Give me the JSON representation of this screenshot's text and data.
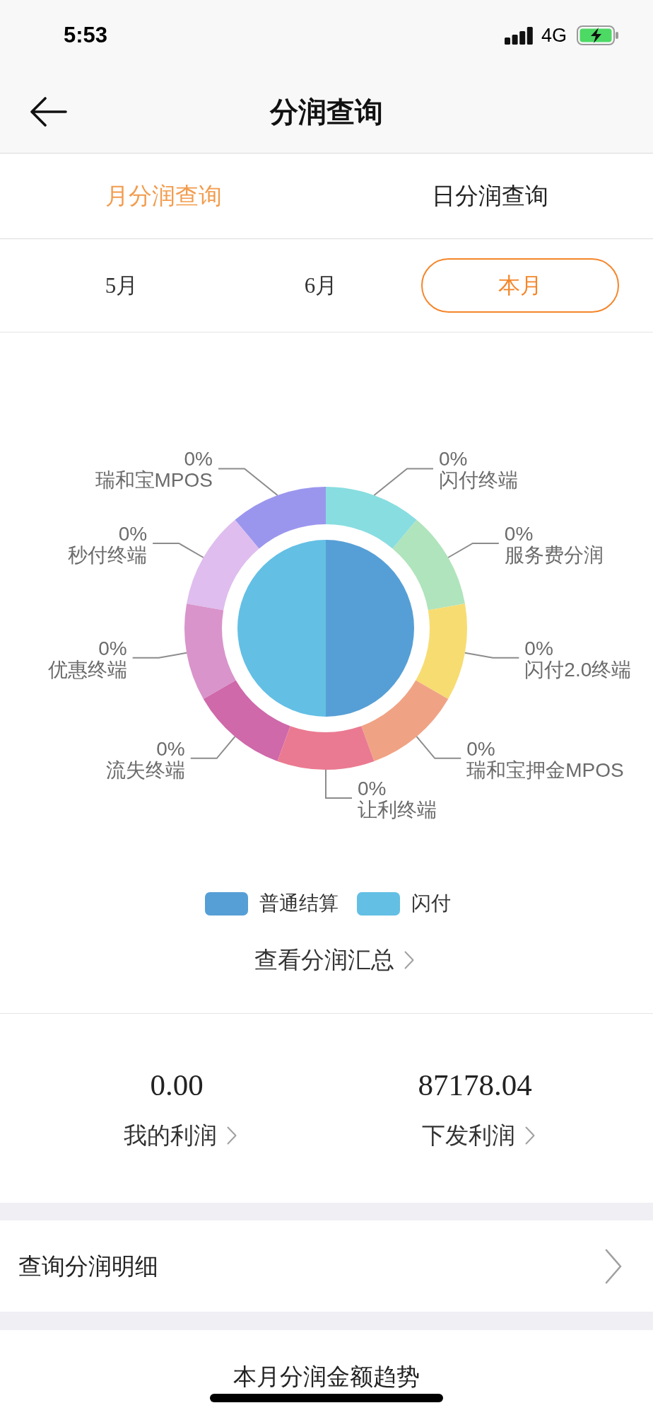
{
  "status_bar": {
    "time": "5:53",
    "network": "4G"
  },
  "nav_bar": {
    "title": "分润查询"
  },
  "tabs": [
    {
      "label": "月分润查询",
      "selected": true
    },
    {
      "label": "日分润查询",
      "selected": false
    }
  ],
  "months": [
    {
      "label": "5月",
      "selected": false
    },
    {
      "label": "6月",
      "selected": false
    },
    {
      "label": "本月",
      "selected": true
    }
  ],
  "chart": {
    "inner_pie": {
      "chart_data": {
        "type": "pie",
        "categories": [
          "普通结算",
          "闪付"
        ],
        "values": [
          50,
          50
        ],
        "colors": [
          "#569fd6",
          "#63bfe4"
        ]
      }
    },
    "outer_ring": {
      "segments": [
        {
          "label": "瑞和宝MPOS",
          "percent": "0%",
          "color": "#9b96ed"
        },
        {
          "label": "闪付终端",
          "percent": "0%",
          "color": "#88dde0"
        },
        {
          "label": "秒付终端",
          "percent": "0%",
          "color": "#dfbdee"
        },
        {
          "label": "服务费分润",
          "percent": "0%",
          "color": "#b0e4bc"
        },
        {
          "label": "优惠终端",
          "percent": "0%",
          "color": "#d994cb"
        },
        {
          "label": "闪付2.0终端",
          "percent": "0%",
          "color": "#f7dc72"
        },
        {
          "label": "流失终端",
          "percent": "0%",
          "color": "#cf69aa"
        },
        {
          "label": "瑞和宝押金MPOS",
          "percent": "0%",
          "color": "#f0a384"
        },
        {
          "label": "让利终端",
          "percent": "0%",
          "color": "#ea7a91"
        }
      ]
    }
  },
  "summary_link": {
    "label": "查看分润汇总"
  },
  "profits": [
    {
      "amount": "0.00",
      "label": "我的利润"
    },
    {
      "amount": "87178.04",
      "label": "下发利润"
    }
  ],
  "detail_link": {
    "label": "查询分润明细"
  },
  "trend": {
    "title": "本月分润金额趋势"
  }
}
